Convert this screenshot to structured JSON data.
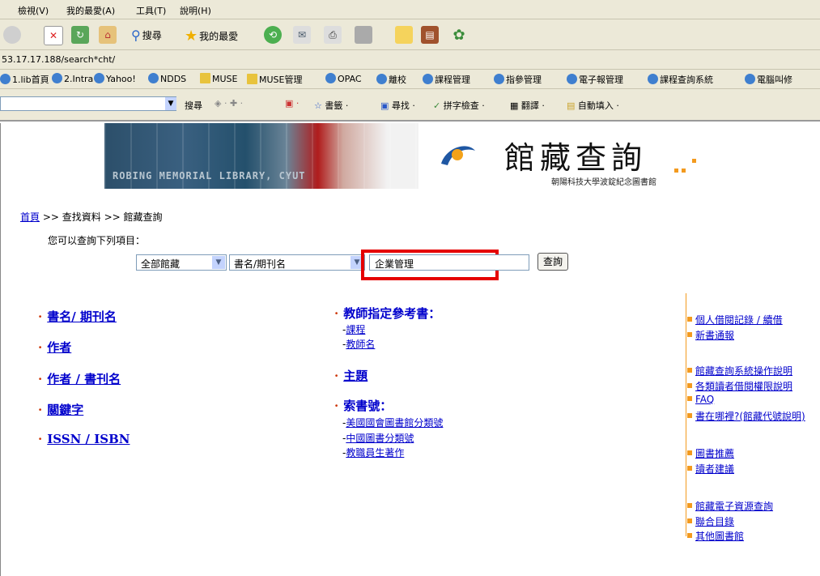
{
  "menu": [
    "檢視(V)",
    "我的最愛(A)",
    "工具(T)",
    "說明(H)"
  ],
  "toolbar": {
    "search": "搜尋",
    "favorites": "我的最愛"
  },
  "address": "53.17.17.188/search*cht/",
  "links": [
    "1.lib首頁",
    "2.Intra",
    "Yahoo!",
    "NDDS",
    "MUSE",
    "MUSE管理",
    "OPAC",
    "離校",
    "課程管理",
    "指參管理",
    "電子報管理",
    "課程查詢系統",
    "電腦叫修"
  ],
  "google": {
    "search": "搜尋",
    "bookmarks": "書籤",
    "find": "尋找",
    "spell": "拼字檢查",
    "translate": "翻譯",
    "autofill": "自動填入"
  },
  "banner": {
    "spine_text": "ROBING MEMORIAL LIBRARY, CYUT",
    "title": "館藏查詢",
    "subtitle": "朝陽科技大學波錠紀念圖書館"
  },
  "breadcrumb": {
    "home": "首頁",
    "rest": ">> 查找資料 >> 館藏查詢"
  },
  "query_prompt": "您可以查詢下列項目：",
  "search": {
    "scope": "全部館藏",
    "field": "書名/期刊名",
    "value": "企業管理",
    "button": "查詢"
  },
  "left_categories": [
    "書名/ 期刊名",
    "作者",
    "作者 / 書刊名",
    "關鍵字",
    "ISSN / ISBN"
  ],
  "middle": {
    "reserve": "教師指定參考書：",
    "reserve_items": [
      "課程",
      "教師名"
    ],
    "subject": "主題",
    "callno": "索書號：",
    "callno_items": [
      "美國國會圖書館分類號",
      "中國圖書分類號",
      "教職員生著作"
    ]
  },
  "right_links": [
    "個人借閱記錄 / 續借",
    "新書通報",
    "館藏查詢系統操作說明",
    "各類讀者借閱權限說明",
    "FAQ",
    "書在哪裡?(館藏代號說明)",
    "圖書推薦",
    "讀者建議",
    "館藏電子資源查詢",
    "聯合目錄",
    "其他圖書館"
  ]
}
